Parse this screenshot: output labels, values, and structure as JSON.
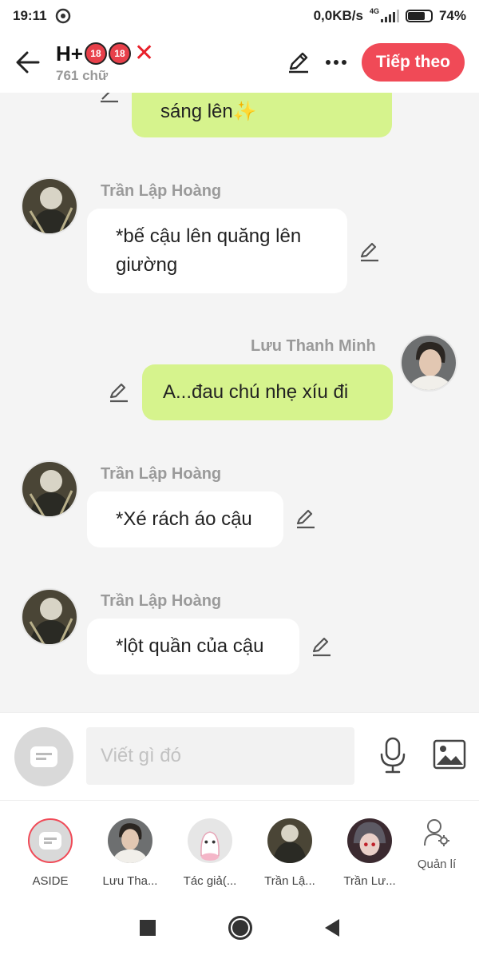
{
  "status_bar": {
    "time": "19:11",
    "net_speed": "0,0KB/s",
    "network": "4G",
    "battery": "74%",
    "battery_level": 0.74
  },
  "header": {
    "title_prefix": "H+",
    "badge": "18",
    "word_count": "761 chữ",
    "next_label": "Tiếp theo",
    "icons": [
      "back-arrow-icon",
      "edit-icon",
      "more-icon"
    ]
  },
  "messages": [
    {
      "sender": "Lưu Thanh Minh",
      "side": "out",
      "lines": [
        "sáng lên✨"
      ]
    },
    {
      "sender": "Trần Lập Hoàng",
      "side": "in",
      "lines": [
        "*bế cậu lên quăng lên",
        "giường"
      ]
    },
    {
      "sender": "Lưu Thanh Minh",
      "side": "out",
      "lines": [
        "A...đau chú nhẹ xíu đi"
      ]
    },
    {
      "sender": "Trần Lập Hoàng",
      "side": "in",
      "lines": [
        "*Xé rách áo cậu"
      ]
    },
    {
      "sender": "Trần Lập Hoàng",
      "side": "in",
      "lines": [
        "*lột quần của cậu"
      ]
    }
  ],
  "composer": {
    "placeholder": "Viết gì đó"
  },
  "characters": [
    {
      "label": "ASIDE",
      "selected": true
    },
    {
      "label": "Lưu Tha..."
    },
    {
      "label": "Tác giả(..."
    },
    {
      "label": "Trần Lậ..."
    },
    {
      "label": "Trần Lư..."
    }
  ],
  "manage_label": "Quản lí",
  "colors": {
    "accent": "#f04a57",
    "outgoing_bubble": "#d6f38d",
    "incoming_bubble": "#ffffff",
    "background": "#f4f4f4"
  }
}
